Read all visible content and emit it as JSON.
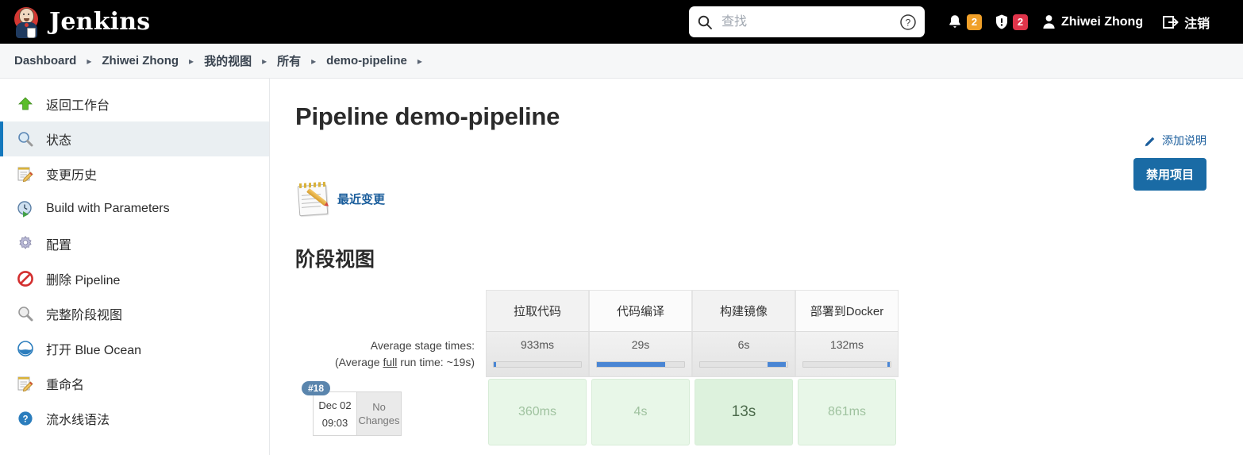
{
  "header": {
    "brand": "Jenkins",
    "logo_icon": "jenkins-butler-logo",
    "search": {
      "icon": "search-icon",
      "placeholder": "查找",
      "value": "",
      "help_icon": "help-circle-icon"
    },
    "notifications": {
      "icon": "bell-icon",
      "count": "2",
      "color": "#f0a029"
    },
    "security": {
      "icon": "shield-alert-icon",
      "count": "2",
      "color": "#e0344a"
    },
    "user": {
      "icon": "user-icon",
      "name": "Zhiwei Zhong"
    },
    "logout": {
      "icon": "logout-icon",
      "label": "注销"
    }
  },
  "breadcrumbs": [
    {
      "label": "Dashboard"
    },
    {
      "label": "Zhiwei Zhong"
    },
    {
      "label": "我的视图"
    },
    {
      "label": "所有"
    },
    {
      "label": "demo-pipeline"
    }
  ],
  "sidebar": {
    "items": [
      {
        "label": "返回工作台",
        "icon": "up-arrow-icon",
        "active": false
      },
      {
        "label": "状态",
        "icon": "magnifier-icon",
        "active": true
      },
      {
        "label": "变更历史",
        "icon": "notepad-pencil-icon",
        "active": false
      },
      {
        "label": "Build with Parameters",
        "icon": "clock-play-icon",
        "active": false
      },
      {
        "label": "配置",
        "icon": "gear-icon",
        "active": false
      },
      {
        "label": "删除 Pipeline",
        "icon": "no-entry-icon",
        "active": false
      },
      {
        "label": "完整阶段视图",
        "icon": "magnifier-icon",
        "active": false
      },
      {
        "label": "打开 Blue Ocean",
        "icon": "blue-ocean-icon",
        "active": false
      },
      {
        "label": "重命名",
        "icon": "notepad-pencil-icon",
        "active": false
      },
      {
        "label": "流水线语法",
        "icon": "question-circle-icon",
        "active": false
      }
    ]
  },
  "main": {
    "page_title": "Pipeline demo-pipeline",
    "add_description": {
      "label": "添加说明",
      "icon": "pencil-icon"
    },
    "disable_project_button": "禁用项目",
    "recent_changes": {
      "label": "最近变更",
      "icon": "notepad-pencil-icon"
    },
    "stage_view": {
      "section_title": "阶段视图",
      "average_label_line1": "Average stage times:",
      "average_label_line2_pre": "(Average ",
      "average_label_line2_underline": "full",
      "average_label_line2_post": " run time: ~19s)",
      "columns": [
        "拉取代码",
        "代码编译",
        "构建镜像",
        "部署到Docker"
      ],
      "average_times": [
        "933ms",
        "29s",
        "6s",
        "132ms"
      ],
      "average_bars": [
        {
          "start_pct": 0,
          "width_pct": 3
        },
        {
          "start_pct": 0,
          "width_pct": 78
        },
        {
          "start_pct": 77,
          "width_pct": 21
        },
        {
          "start_pct": 96,
          "width_pct": 3
        }
      ],
      "runs": [
        {
          "number": "#18",
          "date": "Dec 02",
          "time": "09:03",
          "changes_line1": "No",
          "changes_line2": "Changes",
          "stages": [
            {
              "duration": "360ms",
              "highlight": false
            },
            {
              "duration": "4s",
              "highlight": false
            },
            {
              "duration": "13s",
              "highlight": true
            },
            {
              "duration": "861ms",
              "highlight": false
            }
          ]
        }
      ]
    }
  }
}
